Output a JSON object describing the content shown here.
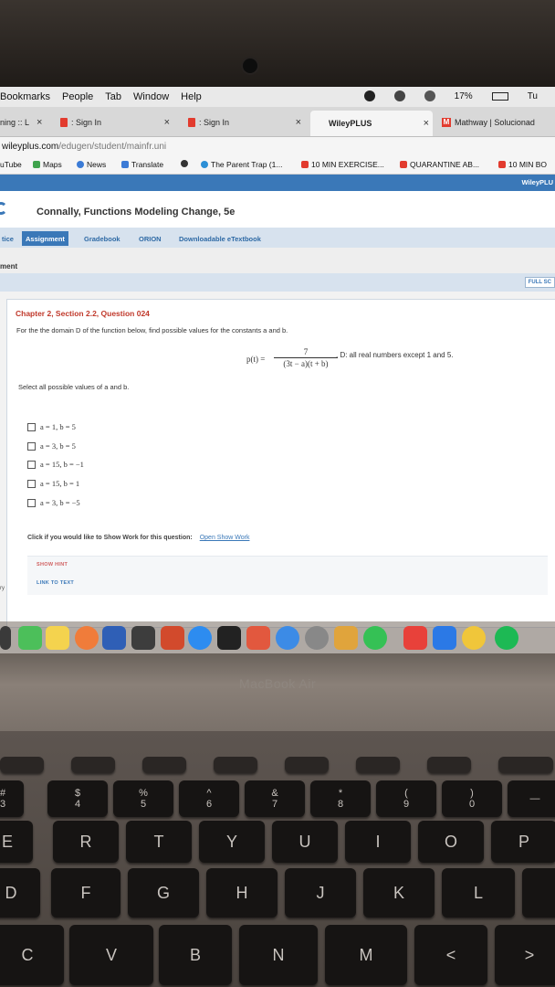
{
  "menubar": {
    "items": [
      "Bookmarks",
      "People",
      "Tab",
      "Window",
      "Help"
    ],
    "battery": "17%",
    "clock": "Tu"
  },
  "tabs": [
    {
      "label": "ning :: L"
    },
    {
      "label": ": Sign In"
    },
    {
      "label": ": Sign In"
    },
    {
      "label": "WileyPLUS"
    },
    {
      "label": "Mathway | Solucionad"
    }
  ],
  "address": {
    "host": "wileyplus.com",
    "path": "/edugen/student/mainfr.uni"
  },
  "bookmarks": [
    "uTube",
    "Maps",
    "News",
    "Translate",
    "The Parent Trap (1...",
    "10 MIN EXERCISE...",
    "QUARANTINE AB...",
    "10 MIN BO"
  ],
  "wiley": {
    "strip_label": "WileyPLU",
    "course_title": "Connally, Functions Modeling Change, 5e",
    "nav": [
      "tice",
      "Assignment",
      "Gradebook",
      "ORION",
      "Downloadable eTextbook"
    ],
    "section_label": "ment",
    "fullscreen": "FULL SC"
  },
  "question": {
    "title": "Chapter 2, Section 2.2, Question 024",
    "prompt": "For the the domain D of the function below, find possible values for the constants a and b.",
    "formula_lhs": "p(t) =",
    "formula_num": "7",
    "formula_den": "(3t − a)(t + b)",
    "domain": ", D: all real numbers except 1 and 5.",
    "select_label": "Select all possible values of a and b.",
    "options": [
      "a = 1, b = 5",
      "a = 3, b = 5",
      "a = 15, b = −1",
      "a = 15, b = 1",
      "a = 3, b = −5"
    ],
    "show_work_text": "Click if you would like to Show Work for this question:",
    "show_work_link": "Open Show Work",
    "hint_label": "SHOW HINT",
    "text_link_label": "LINK TO TEXT",
    "side_label": "ry"
  },
  "laptop": {
    "brand": "MacBook Air"
  },
  "keys": {
    "row_nums": [
      "#\n3",
      "$\n4",
      "%\n5",
      "^\n6",
      "&\n7",
      "*\n8",
      "(\n9",
      ")\n0",
      "—"
    ],
    "row_top": [
      "E",
      "R",
      "T",
      "Y",
      "U",
      "I",
      "O",
      "P"
    ],
    "row_mid": [
      "D",
      "F",
      "G",
      "H",
      "J",
      "K",
      "L"
    ],
    "row_bot": [
      "C",
      "V",
      "B",
      "N",
      "M",
      "<",
      ">"
    ]
  }
}
